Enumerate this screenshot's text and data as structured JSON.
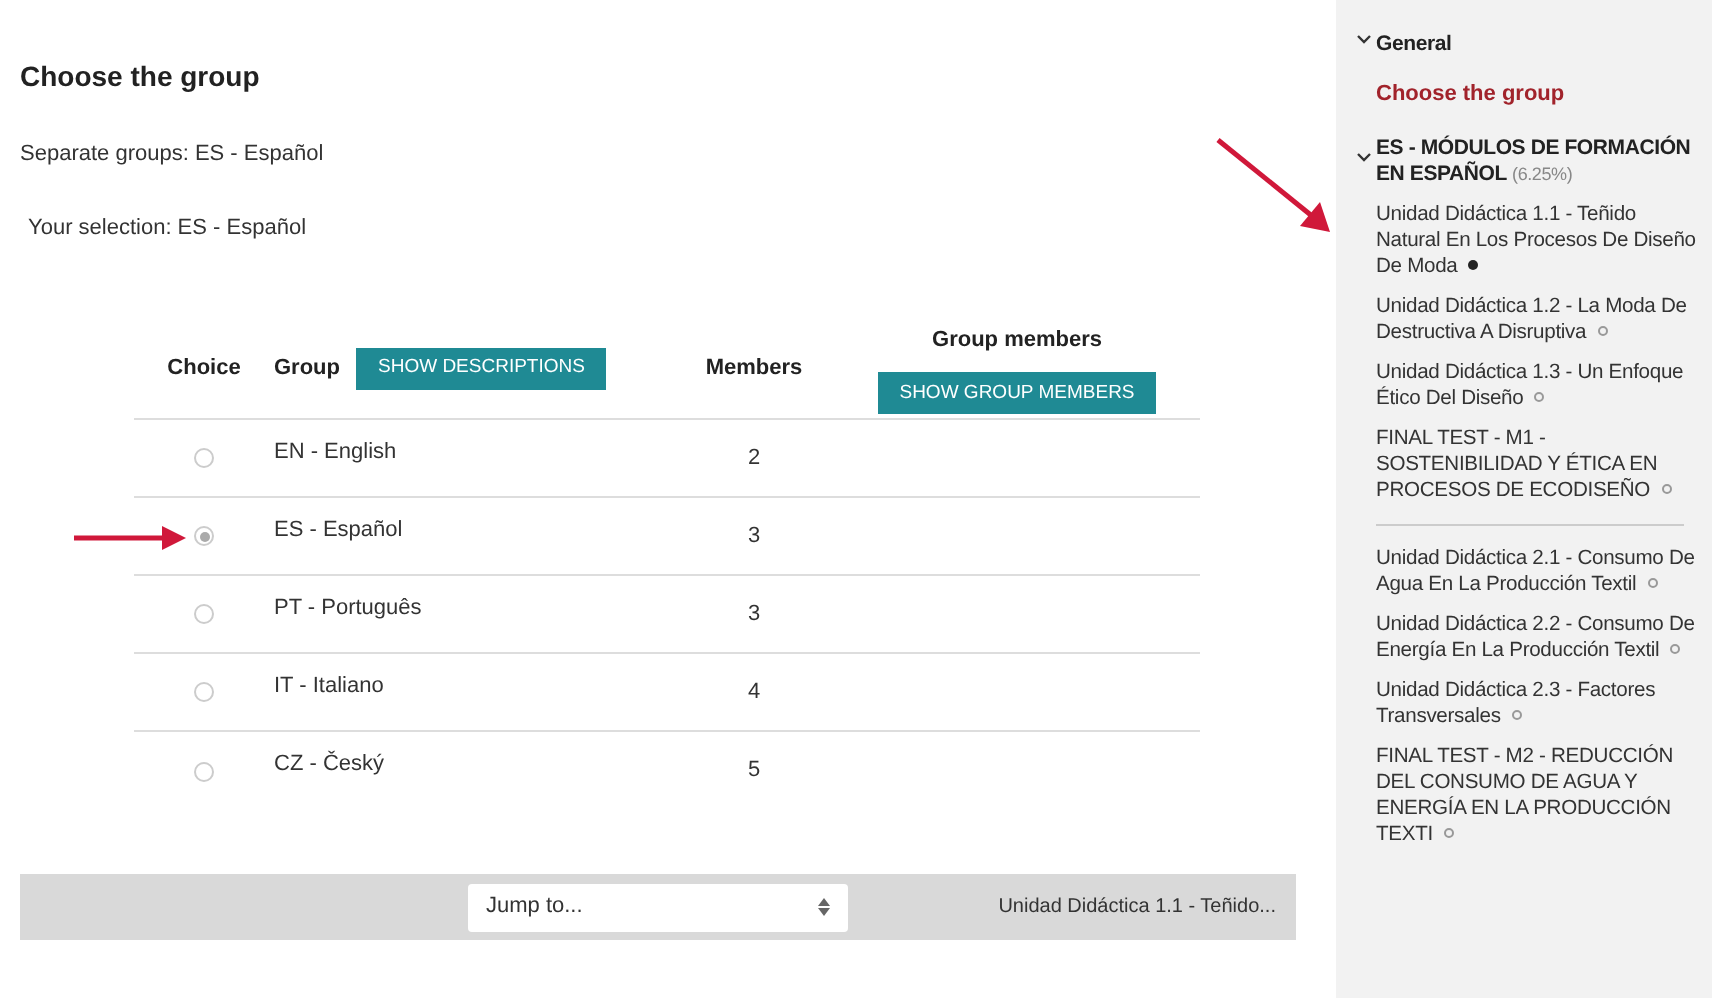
{
  "page": {
    "title": "Choose the group",
    "group_mode": "Separate groups: ES - Español",
    "selection": "Your selection: ES - Español"
  },
  "table": {
    "columns": [
      {
        "label": "Choice"
      },
      {
        "label": "Group",
        "button": "SHOW DESCRIPTIONS"
      },
      {
        "label": "Members"
      },
      {
        "label": "Group members",
        "button": "SHOW GROUP MEMBERS"
      }
    ],
    "rows": [
      {
        "group": "EN - English",
        "members": "2",
        "selected": false,
        "annotated": false
      },
      {
        "group": "ES - Español",
        "members": "3",
        "selected": true,
        "annotated": true
      },
      {
        "group": "PT - Português",
        "members": "3",
        "selected": false,
        "annotated": false
      },
      {
        "group": "IT - Italiano",
        "members": "4",
        "selected": false,
        "annotated": false
      },
      {
        "group": "CZ - Český",
        "members": "5",
        "selected": false,
        "annotated": false
      }
    ]
  },
  "footer": {
    "jump_placeholder": "Jump to...",
    "next_link": "Unidad Didáctica 1.1 - Teñido..."
  },
  "sidebar": {
    "sections": [
      {
        "title": "General",
        "expanded": true,
        "items": [
          {
            "kind": "current",
            "label": "Choose the group"
          }
        ]
      },
      {
        "title": "ES - MÓDULOS DE FORMACIÓN EN ESPAÑOL",
        "progress": "(6.25%)",
        "expanded": true,
        "items": [
          {
            "kind": "activity",
            "label": "Unidad Didáctica 1.1 - Teñido Natural En Los Procesos De Diseño De Moda",
            "completed": true,
            "annotated": true
          },
          {
            "kind": "activity",
            "label": "Unidad Didáctica 1.2 - La Moda De Destructiva A Disruptiva",
            "completed": false,
            "annotated": false
          },
          {
            "kind": "activity",
            "label": "Unidad Didáctica 1.3 - Un Enfoque Ético Del Diseño",
            "completed": false,
            "annotated": false
          },
          {
            "kind": "activity",
            "label": "FINAL TEST - M1 - SOSTENIBILIDAD Y ÉTICA EN PROCESOS DE ECODISEÑO",
            "completed": false,
            "annotated": false
          },
          {
            "kind": "divider"
          },
          {
            "kind": "activity",
            "label": "Unidad Didáctica 2.1 - Consumo De Agua En La Producción Textil",
            "completed": false,
            "annotated": false
          },
          {
            "kind": "activity",
            "label": "Unidad Didáctica 2.2 - Consumo De Energía En La Producción Textil",
            "completed": false,
            "annotated": false
          },
          {
            "kind": "activity",
            "label": "Unidad Didáctica 2.3 - Factores Transversales",
            "completed": false,
            "annotated": false
          },
          {
            "kind": "activity",
            "label": "FINAL TEST - M2 - REDUCCIÓN DEL CONSUMO DE AGUA Y ENERGÍA EN LA PRODUCCIÓN TEXTI",
            "completed": false,
            "annotated": false
          }
        ]
      }
    ]
  }
}
